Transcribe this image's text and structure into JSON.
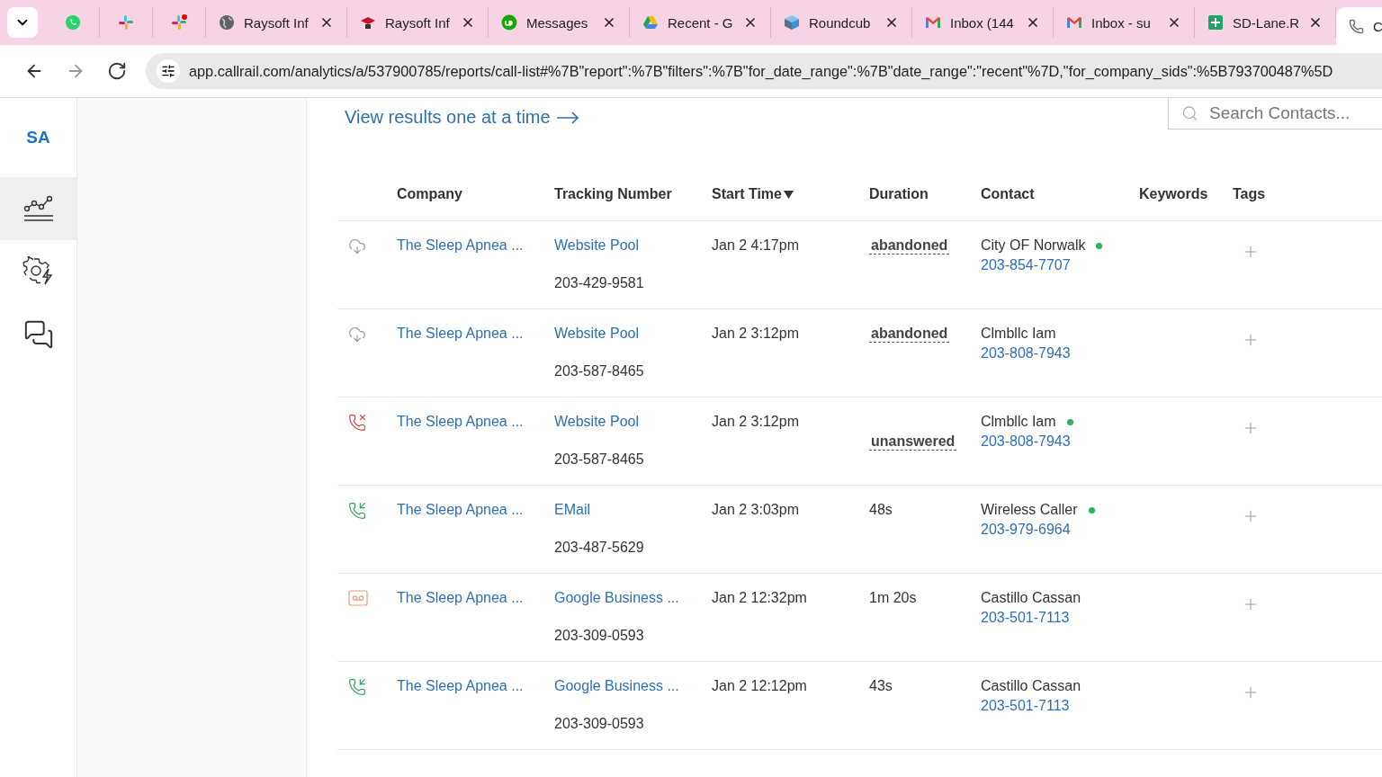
{
  "browser": {
    "tabs": [
      {
        "kind": "whatsapp",
        "selected": false
      },
      {
        "kind": "slack",
        "selected": false
      },
      {
        "kind": "slack-dot",
        "selected": false
      },
      {
        "kind": "globe",
        "title": "Raysoft Inf",
        "selected": false
      },
      {
        "kind": "cap",
        "title": "Raysoft Inf",
        "selected": false
      },
      {
        "kind": "upwork",
        "title": "Messages",
        "selected": false
      },
      {
        "kind": "drive",
        "title": "Recent - G",
        "selected": false
      },
      {
        "kind": "cube",
        "title": "Roundcub",
        "selected": false
      },
      {
        "kind": "mail",
        "title": "Inbox (144",
        "selected": false
      },
      {
        "kind": "mail",
        "title": "Inbox - su",
        "selected": false
      },
      {
        "kind": "sheet",
        "title": "SD-Lane.R",
        "selected": false
      },
      {
        "kind": "phone",
        "title": "C",
        "selected": true
      }
    ],
    "nav_buttons": [
      {
        "kind": "back",
        "disabled": false
      },
      {
        "kind": "forward",
        "disabled": true
      },
      {
        "kind": "reload",
        "disabled": false
      }
    ],
    "url": "app.callrail.com/analytics/a/537900785/reports/call-list#%7B\"report\":%7B\"filters\":%7B\"for_date_range\":%7B\"date_range\":\"recent\"%7D,\"for_company_sids\":%5B793700487%5D"
  },
  "nav": {
    "initials": "SA",
    "items": [
      {
        "kind": "chart",
        "selected": true
      },
      {
        "kind": "gear-bolt",
        "selected": false
      },
      {
        "kind": "chat",
        "selected": false
      }
    ]
  },
  "link": "View results one at a time",
  "search": {
    "placeholder": "Search Contacts..."
  },
  "table": {
    "columns": [
      {
        "label": "Company",
        "sorted": false
      },
      {
        "label": "Tracking Number",
        "sorted": false
      },
      {
        "label": "Start Time",
        "sorted": true
      },
      {
        "label": "Duration",
        "sorted": false
      },
      {
        "label": "Contact",
        "sorted": false
      },
      {
        "label": "Keywords",
        "sorted": false
      },
      {
        "label": "Tags",
        "sorted": false
      }
    ],
    "rows": [
      {
        "kind": "abandoned",
        "company": "The Sleep Apnea ...",
        "source": "Website Pool",
        "number": "203-429-9581",
        "start_time": "Jan 2 4:17pm",
        "duration": {
          "kind": "status",
          "text": "abandoned"
        },
        "contact": "City OF Norwalk",
        "online": true,
        "phone": "203-854-7707"
      },
      {
        "kind": "abandoned",
        "company": "The Sleep Apnea ...",
        "source": "Website Pool",
        "number": "203-587-8465",
        "start_time": "Jan 2 3:12pm",
        "duration": {
          "kind": "status",
          "text": "abandoned"
        },
        "contact": "Clmbllc Iam",
        "online": false,
        "phone": "203-808-7943"
      },
      {
        "kind": "missed",
        "company": "The Sleep Apnea ...",
        "source": "Website Pool",
        "number": "203-587-8465",
        "start_time": "Jan 2 3:12pm",
        "duration": {
          "kind": "status-low",
          "text": "unanswered"
        },
        "contact": "Clmbllc Iam",
        "online": true,
        "phone": "203-808-7943"
      },
      {
        "kind": "inbound",
        "company": "The Sleep Apnea ...",
        "source": "EMail",
        "number": "203-487-5629",
        "start_time": "Jan 2 3:03pm",
        "duration": {
          "kind": "time",
          "text": "48s"
        },
        "contact": "Wireless Caller",
        "online": true,
        "phone": "203-979-6964"
      },
      {
        "kind": "voicemail",
        "company": "The Sleep Apnea ...",
        "source": "Google Business ...",
        "number": "203-309-0593",
        "start_time": "Jan 2 12:32pm",
        "duration": {
          "kind": "time",
          "text": "1m 20s"
        },
        "contact": "Castillo Cassan",
        "online": false,
        "phone": "203-501-7113"
      },
      {
        "kind": "inbound",
        "company": "The Sleep Apnea ...",
        "source": "Google Business ...",
        "number": "203-309-0593",
        "start_time": "Jan 2 12:12pm",
        "duration": {
          "kind": "time",
          "text": "43s"
        },
        "contact": "Castillo Cassan",
        "online": false,
        "phone": "203-501-7113"
      }
    ]
  }
}
